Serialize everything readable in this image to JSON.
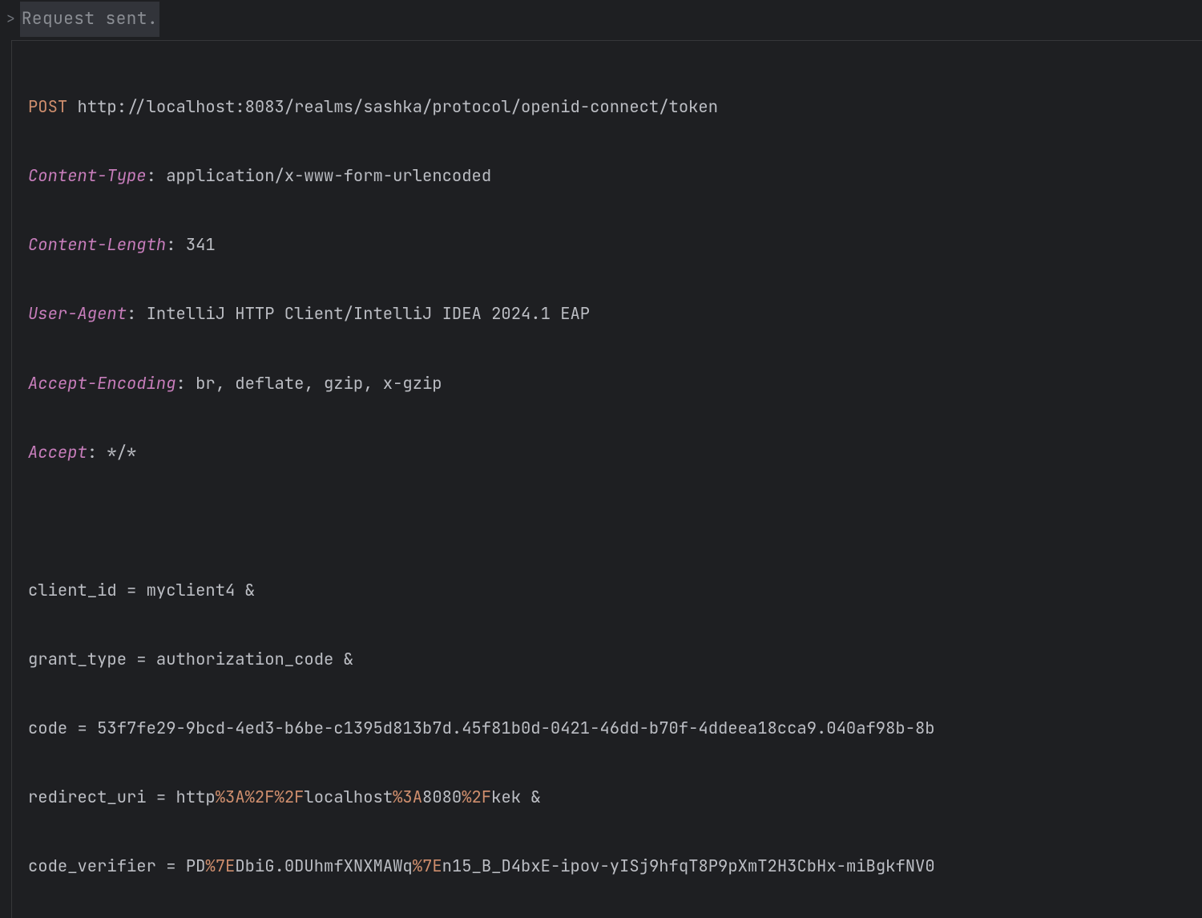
{
  "status": {
    "prompt": ">",
    "text": "Request sent."
  },
  "request": {
    "method": "POST",
    "url": "http://localhost:8083/realms/sashka/protocol/openid-connect/token",
    "headers": [
      {
        "name": "Content-Type",
        "value": "application/x-www-form-urlencoded"
      },
      {
        "name": "Content-Length",
        "value": "341"
      },
      {
        "name": "User-Agent",
        "value": "IntelliJ HTTP Client/IntelliJ IDEA 2024.1 EAP"
      },
      {
        "name": "Accept-Encoding",
        "value": "br, deflate, gzip, x-gzip"
      },
      {
        "name": "Accept",
        "value": "*/*"
      }
    ],
    "body": {
      "client_id": {
        "key": "client_id",
        "value": "myclient4",
        "amp": "&"
      },
      "grant_type": {
        "key": "grant_type",
        "value": "authorization_code",
        "amp": "&"
      },
      "code": {
        "key": "code",
        "value": "53f7fe29-9bcd-4ed3-b6be-c1395d813b7d.45f81b0d-0421-46dd-b70f-4ddeea18cca9.040af98b-8b",
        "amp": ""
      },
      "redirect_uri": {
        "key": "redirect_uri",
        "parts": [
          {
            "t": "plain",
            "v": "http"
          },
          {
            "t": "enc",
            "v": "%3A%2F%2F"
          },
          {
            "t": "plain",
            "v": "localhost"
          },
          {
            "t": "enc",
            "v": "%3A"
          },
          {
            "t": "plain",
            "v": "8080"
          },
          {
            "t": "enc",
            "v": "%2F"
          },
          {
            "t": "plain",
            "v": "kek "
          },
          {
            "t": "plain",
            "v": "&"
          }
        ]
      },
      "code_verifier": {
        "key": "code_verifier",
        "parts": [
          {
            "t": "plain",
            "v": "PD"
          },
          {
            "t": "enc",
            "v": "%7E"
          },
          {
            "t": "plain",
            "v": "DbiG.0DUhmfXNXMAWq"
          },
          {
            "t": "enc",
            "v": "%7E"
          },
          {
            "t": "plain",
            "v": "n15_B_D4bxE-ipov-yISj9hfqT8P9pXmT2H3CbHx-miBgkfNV0"
          }
        ]
      }
    }
  }
}
